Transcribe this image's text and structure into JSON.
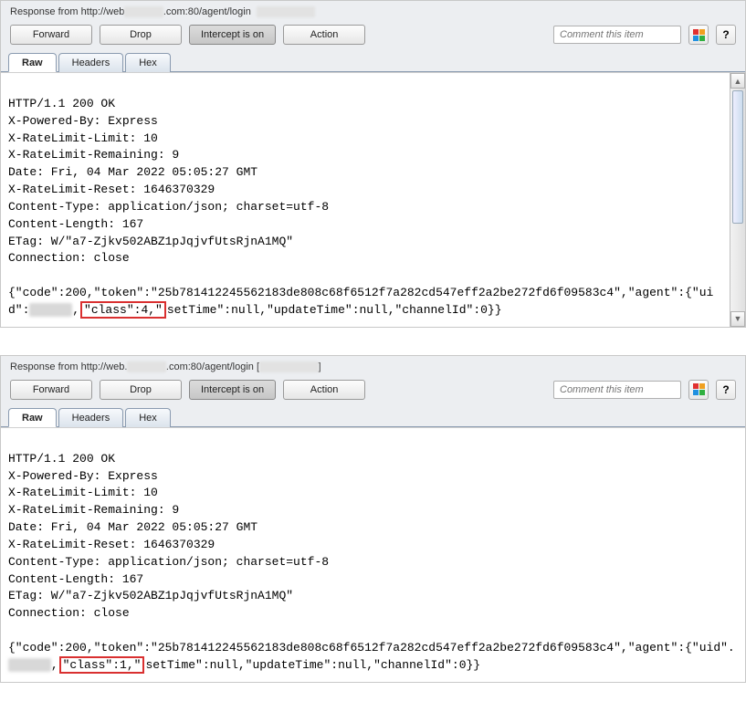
{
  "panels": [
    {
      "titlePrefix": "Response from http://web",
      "titleSuffix": ".com:80/agent/login",
      "toolbar": {
        "forward": "Forward",
        "drop": "Drop",
        "intercept": "Intercept is on",
        "action": "Action",
        "commentPlaceholder": "Comment this item",
        "help": "?"
      },
      "tabs": {
        "raw": "Raw",
        "headers": "Headers",
        "hex": "Hex"
      },
      "headers": [
        "HTTP/1.1 200 OK",
        "X-Powered-By: Express",
        "X-RateLimit-Limit: 10",
        "X-RateLimit-Remaining: 9",
        "Date: Fri, 04 Mar 2022 05:05:27 GMT",
        "X-RateLimit-Reset: 1646370329",
        "Content-Type: application/json; charset=utf-8",
        "Content-Length: 167",
        "ETag: W/\"a7-Zjkv502ABZ1pJqjvfUtsRjnA1MQ\"",
        "Connection: close"
      ],
      "body": {
        "pre": "{\"code\":200,\"token\":\"25b781412245562183de808c68f6512f7a282cd547eff2a2be272fd6f09583c4\",\"agent\":{\"uid\":",
        "highlight": "\"class\":4,\"",
        "post": "setTime\":null,\"updateTime\":null,\"channelId\":0}}"
      }
    },
    {
      "titlePrefix": "Response from http://web.",
      "titleSuffix": ".com:80/agent/login  [",
      "titleClose": "]",
      "toolbar": {
        "forward": "Forward",
        "drop": "Drop",
        "intercept": "Intercept is on",
        "action": "Action",
        "commentPlaceholder": "Comment this item",
        "help": "?"
      },
      "tabs": {
        "raw": "Raw",
        "headers": "Headers",
        "hex": "Hex"
      },
      "headers": [
        "HTTP/1.1 200 OK",
        "X-Powered-By: Express",
        "X-RateLimit-Limit: 10",
        "X-RateLimit-Remaining: 9",
        "Date: Fri, 04 Mar 2022 05:05:27 GMT",
        "X-RateLimit-Reset: 1646370329",
        "Content-Type: application/json; charset=utf-8",
        "Content-Length: 167",
        "ETag: W/\"a7-Zjkv502ABZ1pJqjvfUtsRjnA1MQ\"",
        "Connection: close"
      ],
      "body": {
        "pre": "{\"code\":200,\"token\":\"25b781412245562183de808c68f6512f7a282cd547eff2a2be272fd6f09583c4\",\"agent\":{\"uid\".",
        "highlight": "\"class\":1,\"",
        "post": "setTime\":null,\"updateTime\":null,\"channelId\":0}}"
      }
    }
  ]
}
